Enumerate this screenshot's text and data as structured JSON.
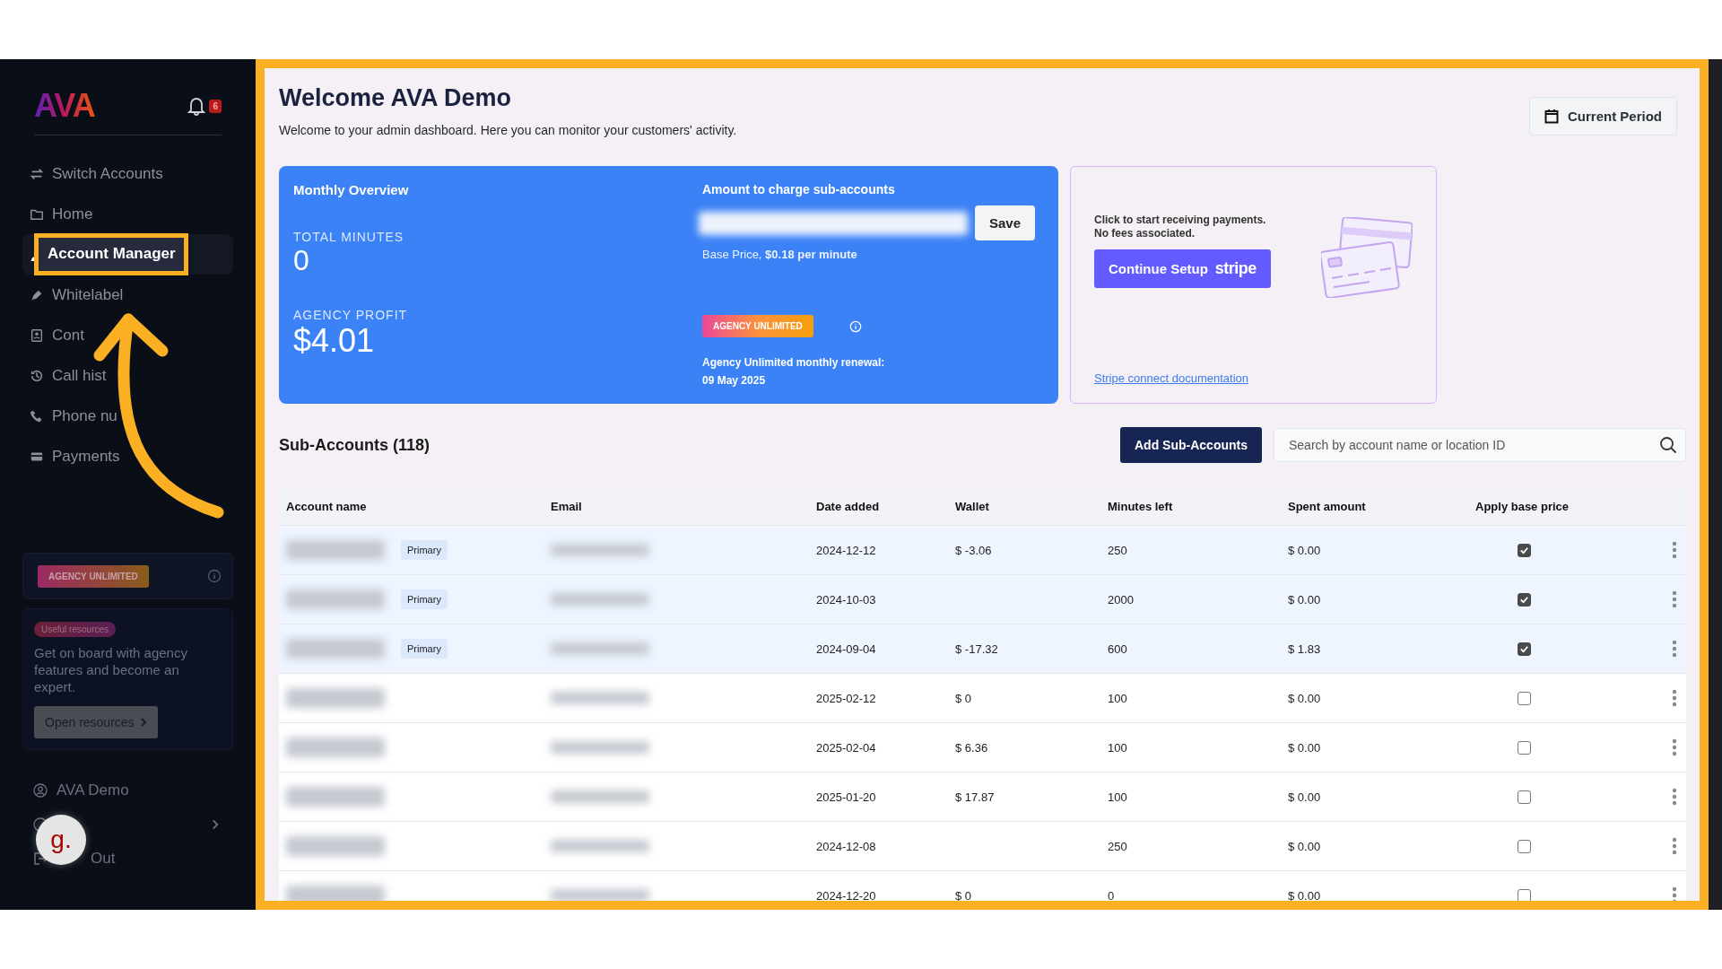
{
  "sidebar": {
    "logo": "AVA",
    "notification_count": "6",
    "nav": [
      {
        "label": "Switch Accounts",
        "selected": false
      },
      {
        "label": "Home",
        "selected": false
      },
      {
        "label": "Account Manager",
        "selected": true
      },
      {
        "label": "Whitelabel",
        "selected": false
      },
      {
        "label": "Cont",
        "selected": false
      },
      {
        "label": "Call hist",
        "selected": false
      },
      {
        "label": "Phone nu",
        "selected": false
      },
      {
        "label": "Payments",
        "selected": false
      }
    ],
    "plan_badge": "AGENCY UNLIMITED",
    "resources": {
      "tag": "Useful resources",
      "text": "Get on board with agency features and become an expert.",
      "button": "Open resources"
    },
    "user": "AVA Demo",
    "logout": "Out",
    "avatar_badge": "g."
  },
  "header": {
    "title": "Welcome AVA Demo",
    "subtitle": "Welcome to your admin dashboard. Here you can monitor your customers' activity.",
    "period_button": "Current Period"
  },
  "overview": {
    "title": "Monthly Overview",
    "total_minutes_label": "TOTAL MINUTES",
    "total_minutes": "0",
    "profit_label": "AGENCY PROFIT",
    "profit": "$4.01",
    "charge_label": "Amount to charge sub-accounts",
    "save": "Save",
    "base_price": "Base Price, **$0.18 per minute**",
    "plan_badge": "AGENCY UNLIMITED",
    "renewal": "Agency Unlimited monthly renewal:",
    "renewal_date": "09 May 2025"
  },
  "stripe": {
    "text": "Click to start receiving payments.",
    "text2": "No fees associated.",
    "button": "Continue Setup",
    "button_logo": "stripe",
    "link": "Stripe connect documentation"
  },
  "sub_accounts": {
    "title": "Sub-Accounts (118)",
    "add_button": "Add Sub-Accounts",
    "search_placeholder": "Search by account name or location ID"
  },
  "table": {
    "columns": [
      "Account name",
      "Email",
      "Date added",
      "Wallet",
      "Minutes left",
      "Spent amount",
      "Apply base price"
    ],
    "rows": [
      {
        "tag": "Primary",
        "highlighted": true,
        "date": "2024-12-12",
        "wallet": "$ -3.06",
        "minutes": "250",
        "spent": "$ 0.00",
        "checked": true
      },
      {
        "tag": "Primary",
        "highlighted": true,
        "date": "2024-10-03",
        "minutes": "2000",
        "spent": "$ 0.00",
        "checked": true
      },
      {
        "tag": "Primary",
        "highlighted": true,
        "date": "2024-09-04",
        "wallet": "$ -17.32",
        "minutes": "600",
        "spent": "$ 1.83",
        "checked": true
      },
      {
        "highlighted": false,
        "date": "2025-02-12",
        "wallet": "$ 0",
        "minutes": "100",
        "spent": "$ 0.00",
        "checked": false
      },
      {
        "highlighted": false,
        "date": "2025-02-04",
        "wallet": "$ 6.36",
        "minutes": "100",
        "spent": "$ 0.00",
        "checked": false
      },
      {
        "highlighted": false,
        "date": "2025-01-20",
        "wallet": "$ 17.87",
        "minutes": "100",
        "spent": "$ 0.00",
        "checked": false
      },
      {
        "highlighted": false,
        "date": "2024-12-08",
        "minutes": "250",
        "spent": "$ 0.00",
        "checked": false
      },
      {
        "highlighted": false,
        "date": "2024-12-20",
        "wallet": "$ 0",
        "minutes": "0",
        "spent": "$ 0.00",
        "checked": false
      }
    ]
  }
}
